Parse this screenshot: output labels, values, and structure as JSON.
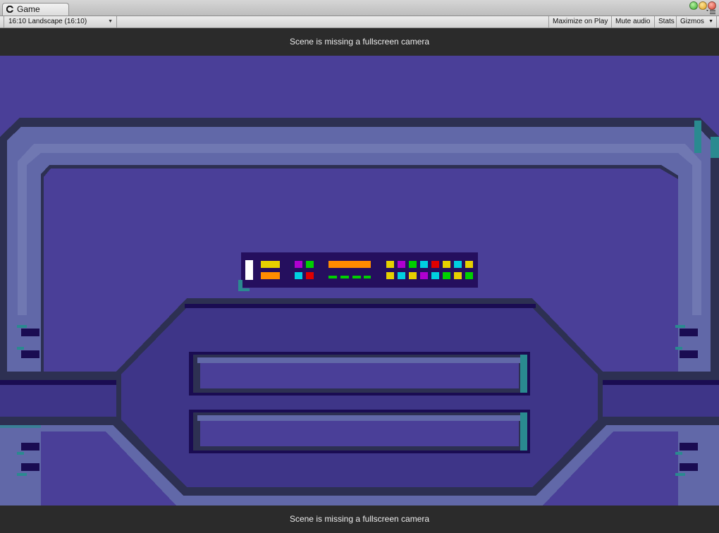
{
  "window": {
    "tab_title": "Game"
  },
  "toolbar": {
    "aspect_label": "16:10 Landscape (16:10)",
    "maximize_label": "Maximize on Play",
    "mute_label": "Mute audio",
    "stats_label": "Stats",
    "gizmos_label": "Gizmos"
  },
  "game_view": {
    "camera_warning_top": "Scene is missing a fullscreen camera",
    "camera_warning_bottom": "Scene is missing a fullscreen camera"
  },
  "palette": {
    "background": "#4a3f98",
    "frame_light": "#6168a8",
    "frame_dark": "#2d3052",
    "frame_deep": "#1a0c52",
    "teal": "#2a8a90",
    "center_fill": "#3e3588",
    "panel_bg": "#250f5e"
  },
  "hud_panel": {
    "top_row": [
      "#e6d000",
      "#b000d0",
      "#00d000",
      "#ff8c00",
      "#e6d000",
      "#b000d0",
      "#00d000",
      "#00d0e0",
      "#e00000",
      "#e6d000",
      "#00d0e0",
      "#e6d000"
    ],
    "bottom_row": [
      "#ff8c00",
      "#00d0e0",
      "#e00000",
      "#00d000",
      "#e6d000",
      "#00d0e0",
      "#e6d000",
      "#b000d0",
      "#00d0e0",
      "#00d000",
      "#e6d000",
      "#00d000"
    ]
  }
}
